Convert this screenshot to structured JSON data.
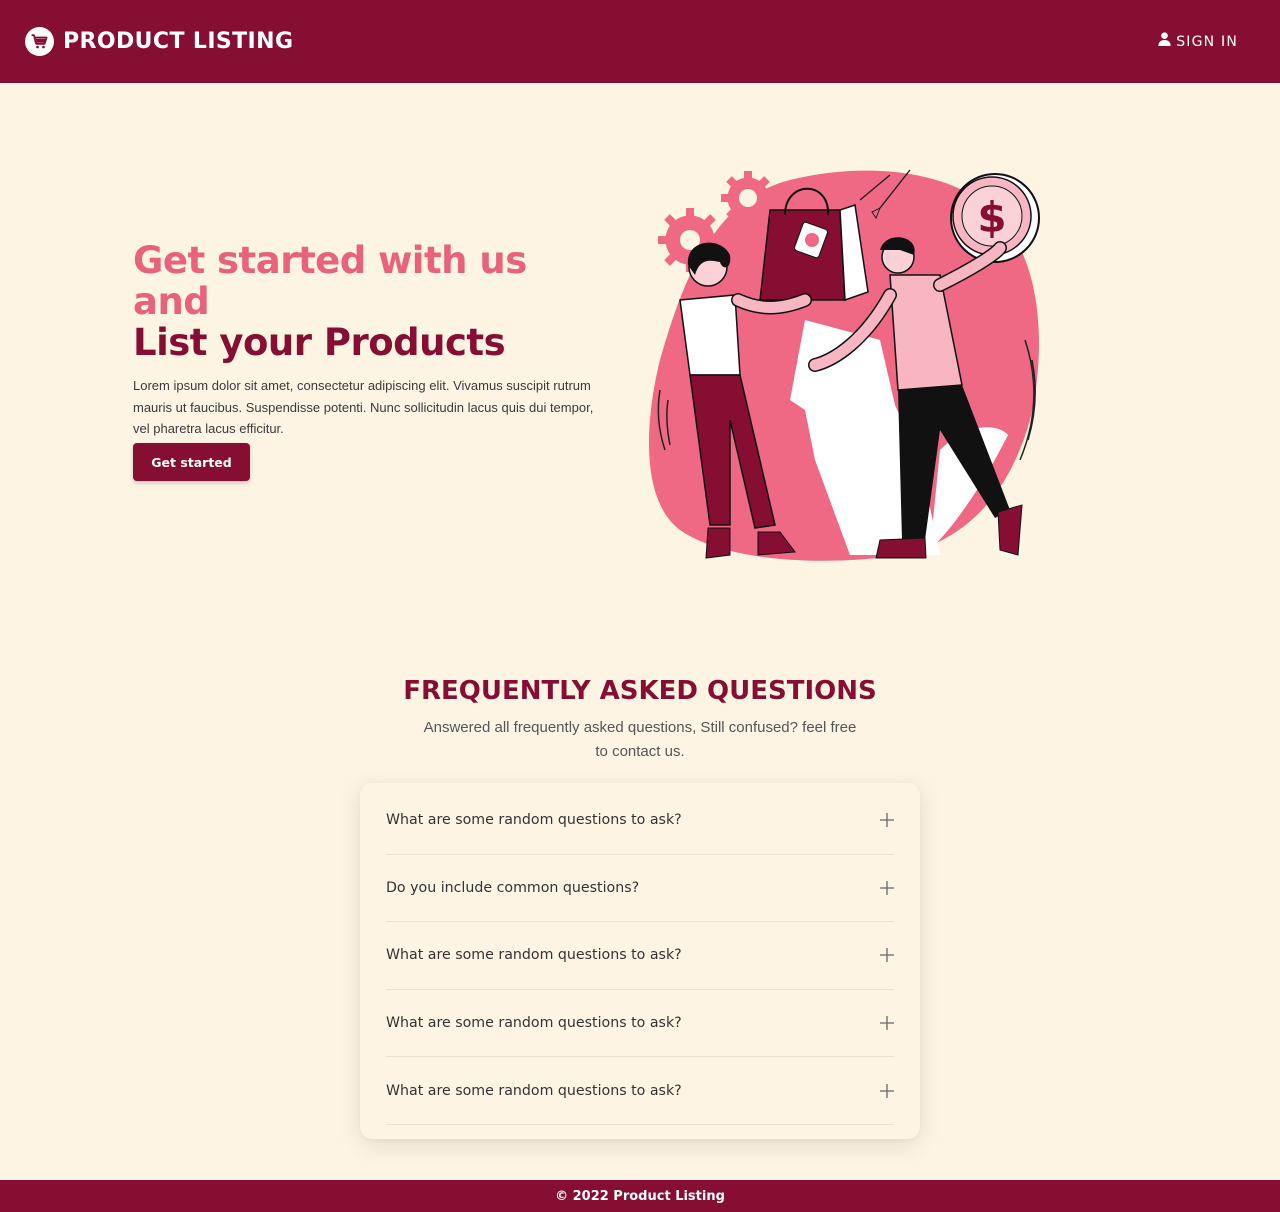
{
  "header": {
    "brand_name": "PRODUCT LISTING",
    "brand_icon": "cart-icon",
    "signin_icon": "user-icon",
    "signin_label": "SIGN IN"
  },
  "hero": {
    "title_line1": "Get started with us and",
    "title_line2": "List your Products",
    "description": "Lorem ipsum dolor sit amet, consectetur adipiscing elit. Vivamus suscipit rutrum mauris ut faucibus. Suspendisse potenti. Nunc sollicitudin lacus quis dui tempor, vel pharetra lacus efficitur.",
    "cta_label": "Get started",
    "illustration": "shopping-illustration"
  },
  "faq": {
    "title": "FREQUENTLY ASKED QUESTIONS",
    "subtitle": "Answered all frequently asked questions, Still confused? feel free to contact us.",
    "toggle_icon": "plus-icon",
    "items": [
      {
        "question": "What are some random questions to ask?"
      },
      {
        "question": "Do you include common questions?"
      },
      {
        "question": "What are some random questions to ask?"
      },
      {
        "question": "What are some random questions to ask?"
      },
      {
        "question": "What are some random questions to ask?"
      }
    ]
  },
  "footer": {
    "copyright": "© 2022 Product Listing"
  },
  "colors": {
    "brand": "#870e33",
    "accent": "#e7627a",
    "background": "#fdf4e3"
  }
}
